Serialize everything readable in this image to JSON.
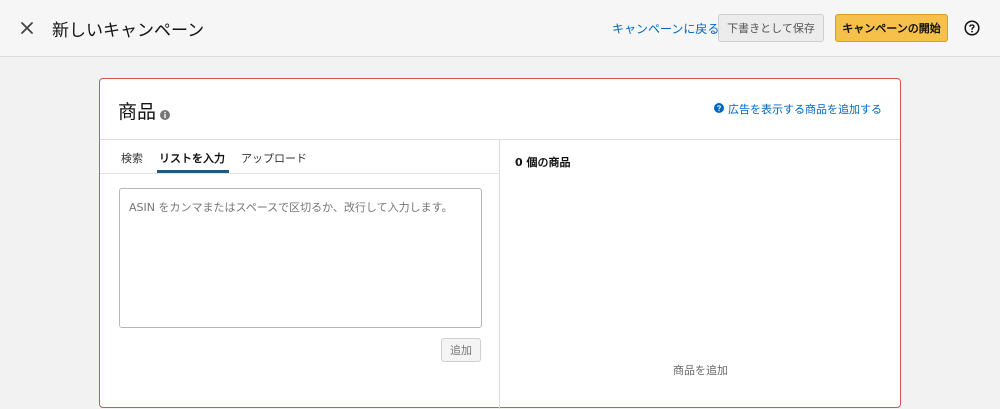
{
  "header": {
    "title": "新しいキャンペーン",
    "back_link": "キャンペーンに戻る",
    "save_draft": "下書きとして保存",
    "start_campaign": "キャンペーンの開始"
  },
  "products": {
    "title": "商品",
    "add_products_link": "広告を表示する商品を追加する",
    "tabs": [
      {
        "label": "検索"
      },
      {
        "label": "リストを入力"
      },
      {
        "label": "アップロード"
      }
    ],
    "asin_placeholder": "ASIN をカンマまたはスペースで区切るか、改行して入力します。",
    "add_button": "追加",
    "count_label": "0 個の商品",
    "empty_text": "商品を追加"
  },
  "colors": {
    "link": "#0066c0",
    "primary_button": "#f7c04a",
    "card_border_error": "#d9534f",
    "active_tab_underline": "#23597e"
  },
  "icons": {
    "close": "close-icon",
    "help": "help-icon",
    "info": "info-icon",
    "add_link": "question-circle-icon"
  }
}
